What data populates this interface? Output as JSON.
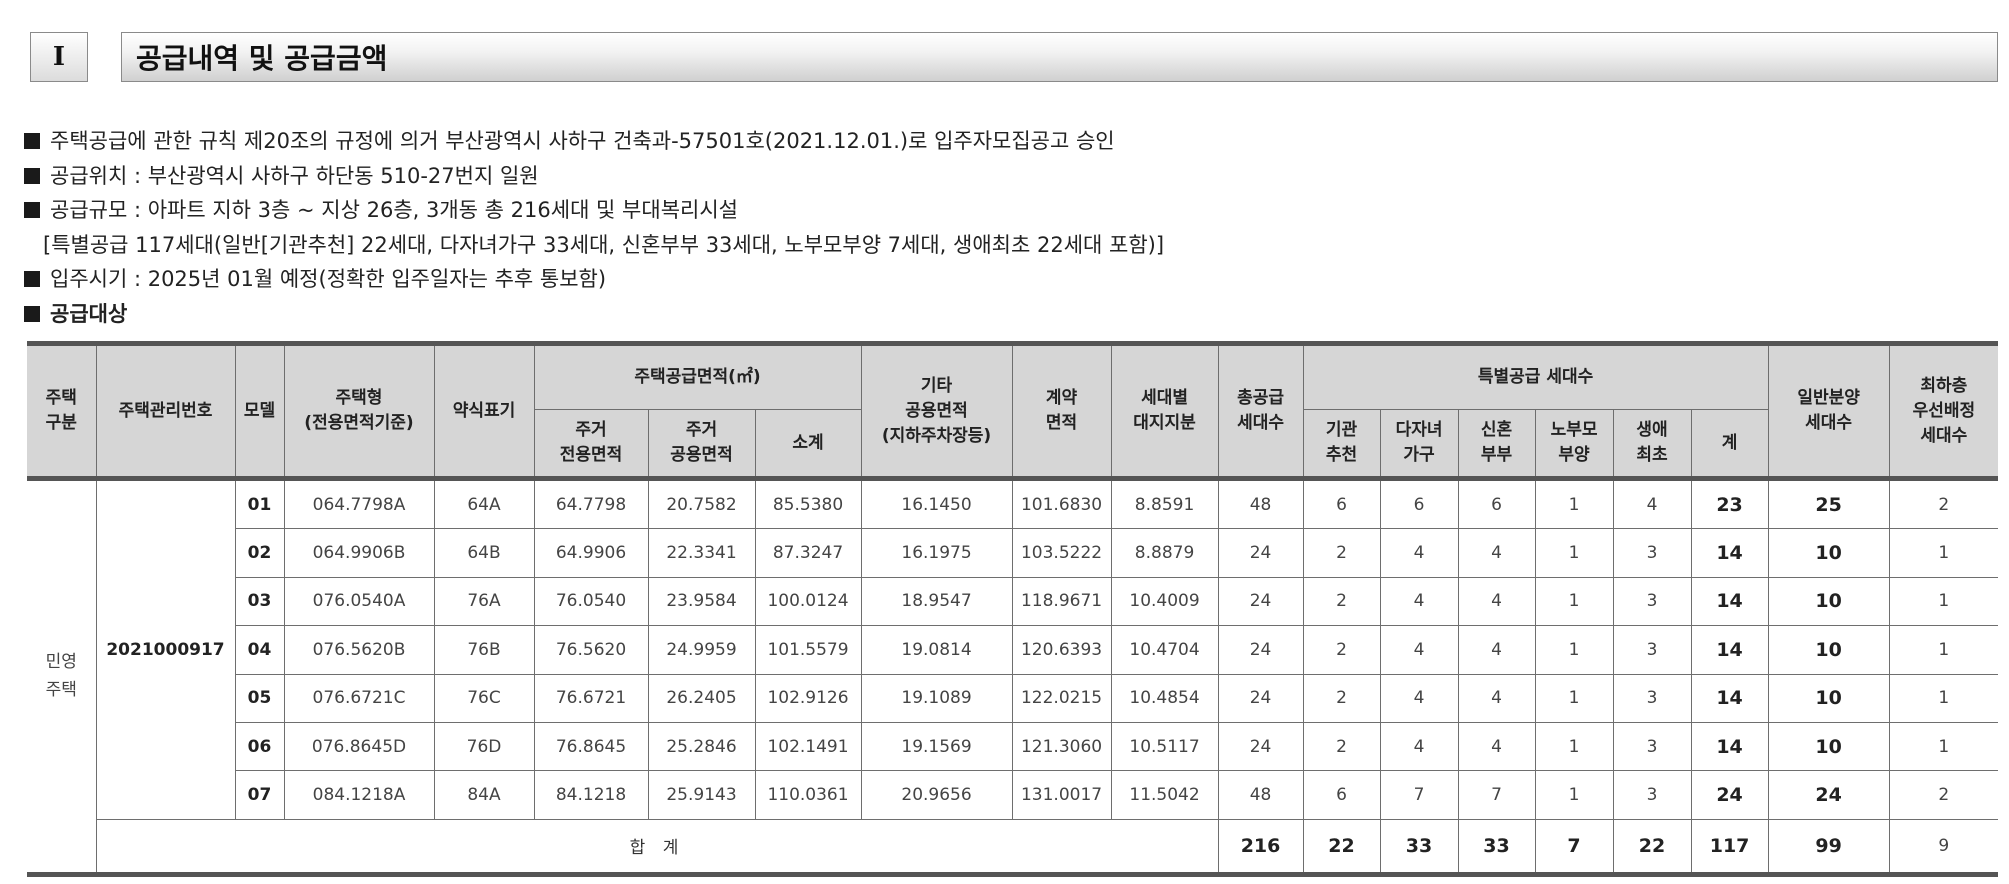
{
  "header": {
    "section_no": "I",
    "title": "공급내역 및 공급금액"
  },
  "bullets": [
    "주택공급에 관한 규칙 제20조의 규정에 의거 부산광역시 사하구 건축과-57501호(2021.12.01.)로 입주자모집공고 승인",
    "공급위치 : 부산광역시 사하구 하단동 510-27번지 일원",
    "공급규모 : 아파트 지하 3층 ~ 지상 26층, 3개동 총 216세대 및 부대복리시설"
  ],
  "bullet_cont": "[특별공급 117세대(일반[기관추천] 22세대, 다자녀가구 33세대, 신혼부부 33세대, 노부모부양 7세대, 생애최초 22세대 포함)]",
  "bullet_move": "입주시기 : 2025년 01월 예정(정확한 입주일자는 추후 통보함)",
  "bullet_target": "공급대상",
  "table": {
    "headers": {
      "house_kind": "주택\n구분",
      "mgmt_no": "주택관리번호",
      "model": "모델",
      "house_type": "주택형\n(전용면적기준)",
      "abbr": "약식표기",
      "area_group": "주택공급면적(㎡)",
      "area_private": "주거\n전용면적",
      "area_common": "주거\n공용면적",
      "area_subtotal": "소계",
      "other_common": "기타\n공용면적\n(지하주차장등)",
      "contract_area": "계약\n면적",
      "land_share": "세대별\n대지지분",
      "total_units": "총공급\n세대수",
      "special_group": "특별공급 세대수",
      "sp_agency": "기관\n추천",
      "sp_multi": "다자녀\n가구",
      "sp_newlywed": "신혼\n부부",
      "sp_elder": "노부모\n부양",
      "sp_first": "생애\n최초",
      "sp_total": "계",
      "general": "일반분양\n세대수",
      "lowest_floor": "최하층\n우선배정\n세대수"
    },
    "house_kind": "민영\n주택",
    "mgmt_no": "2021000917",
    "rows": [
      {
        "model": "01",
        "type": "064.7798A",
        "abbr": "64A",
        "private": "64.7798",
        "common": "20.7582",
        "subtotal": "85.5380",
        "other": "16.1450",
        "contract": "101.6830",
        "land": "8.8591",
        "total": "48",
        "agency": "6",
        "multi": "6",
        "newlywed": "6",
        "elder": "1",
        "first": "4",
        "sp_total": "23",
        "general": "25",
        "lowest": "2"
      },
      {
        "model": "02",
        "type": "064.9906B",
        "abbr": "64B",
        "private": "64.9906",
        "common": "22.3341",
        "subtotal": "87.3247",
        "other": "16.1975",
        "contract": "103.5222",
        "land": "8.8879",
        "total": "24",
        "agency": "2",
        "multi": "4",
        "newlywed": "4",
        "elder": "1",
        "first": "3",
        "sp_total": "14",
        "general": "10",
        "lowest": "1"
      },
      {
        "model": "03",
        "type": "076.0540A",
        "abbr": "76A",
        "private": "76.0540",
        "common": "23.9584",
        "subtotal": "100.0124",
        "other": "18.9547",
        "contract": "118.9671",
        "land": "10.4009",
        "total": "24",
        "agency": "2",
        "multi": "4",
        "newlywed": "4",
        "elder": "1",
        "first": "3",
        "sp_total": "14",
        "general": "10",
        "lowest": "1"
      },
      {
        "model": "04",
        "type": "076.5620B",
        "abbr": "76B",
        "private": "76.5620",
        "common": "24.9959",
        "subtotal": "101.5579",
        "other": "19.0814",
        "contract": "120.6393",
        "land": "10.4704",
        "total": "24",
        "agency": "2",
        "multi": "4",
        "newlywed": "4",
        "elder": "1",
        "first": "3",
        "sp_total": "14",
        "general": "10",
        "lowest": "1"
      },
      {
        "model": "05",
        "type": "076.6721C",
        "abbr": "76C",
        "private": "76.6721",
        "common": "26.2405",
        "subtotal": "102.9126",
        "other": "19.1089",
        "contract": "122.0215",
        "land": "10.4854",
        "total": "24",
        "agency": "2",
        "multi": "4",
        "newlywed": "4",
        "elder": "1",
        "first": "3",
        "sp_total": "14",
        "general": "10",
        "lowest": "1"
      },
      {
        "model": "06",
        "type": "076.8645D",
        "abbr": "76D",
        "private": "76.8645",
        "common": "25.2846",
        "subtotal": "102.1491",
        "other": "19.1569",
        "contract": "121.3060",
        "land": "10.5117",
        "total": "24",
        "agency": "2",
        "multi": "4",
        "newlywed": "4",
        "elder": "1",
        "first": "3",
        "sp_total": "14",
        "general": "10",
        "lowest": "1"
      },
      {
        "model": "07",
        "type": "084.1218A",
        "abbr": "84A",
        "private": "84.1218",
        "common": "25.9143",
        "subtotal": "110.0361",
        "other": "20.9656",
        "contract": "131.0017",
        "land": "11.5042",
        "total": "48",
        "agency": "6",
        "multi": "7",
        "newlywed": "7",
        "elder": "1",
        "first": "3",
        "sp_total": "24",
        "general": "24",
        "lowest": "2"
      }
    ],
    "totals": {
      "label": "합 계",
      "total": "216",
      "agency": "22",
      "multi": "33",
      "newlywed": "33",
      "elder": "7",
      "first": "22",
      "sp_total": "117",
      "general": "99",
      "lowest": "9"
    }
  }
}
